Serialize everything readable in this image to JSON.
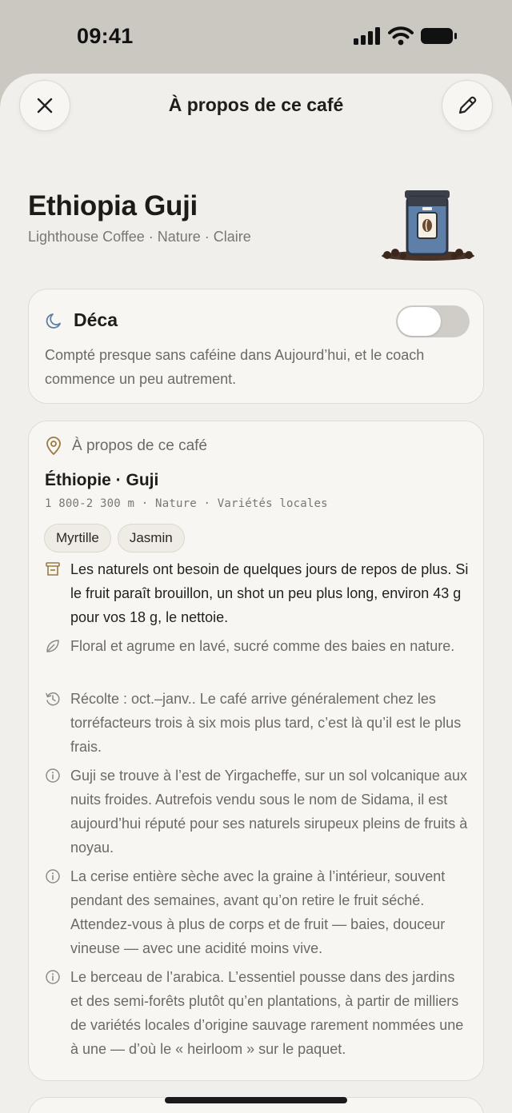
{
  "status": {
    "time": "09:41"
  },
  "header": {
    "title": "À propos de ce café"
  },
  "coffee": {
    "name": "Ethiopia Guji",
    "meta": "Lighthouse Coffee · Nature · Claire"
  },
  "decaf": {
    "title": "Déca",
    "enabled": false,
    "description": "Compté presque sans caféine dans Aujourd’hui, et le coach commence un peu autrement."
  },
  "about": {
    "heading": "À propos de ce café",
    "origin": "Éthiopie · Guji",
    "details": "1 800-2 300 m · Nature · Variétés locales",
    "tags": [
      "Myrtille",
      "Jasmin"
    ],
    "notes": [
      {
        "icon": "brew-icon",
        "text": "Les naturels ont besoin de quelques jours de repos de plus. Si le fruit paraît brouillon, un shot un peu plus long, environ 43 g pour vos 18 g, le nettoie."
      },
      {
        "icon": "leaf-icon",
        "text": "Floral et agrume en lavé, sucré comme des baies en nature."
      },
      {
        "icon": "history-icon",
        "text": "Récolte : oct.–janv.. Le café arrive généralement chez les torréfacteurs trois à six mois plus tard, c’est là qu’il est le plus frais."
      },
      {
        "icon": "info-icon",
        "text": "Guji se trouve à l’est de Yirgacheffe, sur un sol volcanique aux nuits froides. Autrefois vendu sous le nom de Sidama, il est aujourd’hui réputé pour ses naturels sirupeux pleins de fruits à noyau."
      },
      {
        "icon": "info-icon",
        "text": "La cerise entière sèche avec la graine à l’intérieur, souvent pendant des semaines, avant qu’on retire le fruit séché. Attendez-vous à plus de corps et de fruit — baies, douceur vineuse — avec une acidité moins vive."
      },
      {
        "icon": "info-icon",
        "text": "Le berceau de l’arabica. L’essentiel pousse dans des jardins et des semi-forêts plutôt qu’en plantations, à partir de milliers de variétés locales d’origine sauvage rarement nommées une à une — d’où le « heirloom » sur le paquet."
      }
    ]
  },
  "colors": {
    "sheet": "#f1efeb",
    "card": "#f8f6f2",
    "accent_moon": "#5b7fa6",
    "accent_pin": "#9a7a3f",
    "bag_blue": "#5d7fa8"
  }
}
